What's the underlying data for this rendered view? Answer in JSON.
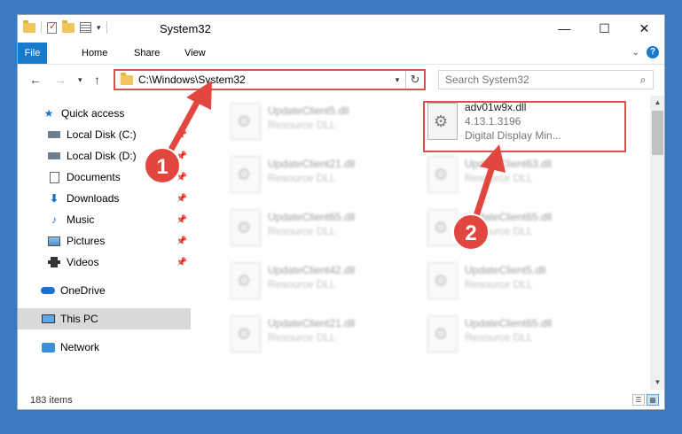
{
  "window": {
    "title": "System32"
  },
  "ribbon": {
    "tabs": [
      "File",
      "Home",
      "Share",
      "View"
    ],
    "help": "?"
  },
  "nav": {
    "address": "C:\\Windows\\System32",
    "search_placeholder": "Search System32"
  },
  "sidebar": {
    "items": [
      {
        "label": "Quick access",
        "icon": "star-icon",
        "pinned": false
      },
      {
        "label": "Local Disk (C:)",
        "icon": "drive-icon",
        "pinned": true
      },
      {
        "label": "Local Disk (D:)",
        "icon": "drive-icon",
        "pinned": true
      },
      {
        "label": "Documents",
        "icon": "documents-icon",
        "pinned": true
      },
      {
        "label": "Downloads",
        "icon": "downloads-icon",
        "pinned": true
      },
      {
        "label": "Music",
        "icon": "music-icon",
        "pinned": true
      },
      {
        "label": "Pictures",
        "icon": "pictures-icon",
        "pinned": true
      },
      {
        "label": "Videos",
        "icon": "videos-icon",
        "pinned": true
      },
      {
        "label": "OneDrive",
        "icon": "cloud-icon",
        "pinned": false
      },
      {
        "label": "This PC",
        "icon": "computer-icon",
        "pinned": false,
        "selected": true
      },
      {
        "label": "Network",
        "icon": "network-icon",
        "pinned": false
      }
    ]
  },
  "files": {
    "left_column": [
      {
        "name": "UpdateClient5.dll",
        "type": "Resource DLL"
      },
      {
        "name": "UpdateClient21.dll",
        "type": "Resource DLL"
      },
      {
        "name": "UpdateClient65.dll",
        "type": "Resource DLL"
      },
      {
        "name": "UpdateClient42.dll",
        "type": "Resource DLL"
      },
      {
        "name": "UpdateClient21.dll",
        "type": "Resource DLL"
      }
    ],
    "right_column": [
      {
        "name": "adv01w9x.dll",
        "version": "4.13.1.3196",
        "description": "Digital Display Min...",
        "highlighted": true
      },
      {
        "name": "UpdateClient63.dll",
        "type": "Resource DLL"
      },
      {
        "name": "UpdateClient65.dll",
        "type": "Resource DLL"
      },
      {
        "name": "UpdateClient5.dll",
        "type": "Resource DLL"
      },
      {
        "name": "UpdateClient65.dll",
        "type": "Resource DLL"
      }
    ]
  },
  "status": {
    "count": "183 items"
  },
  "annotations": {
    "step1": "1",
    "step2": "2",
    "color": "#e2473f"
  }
}
